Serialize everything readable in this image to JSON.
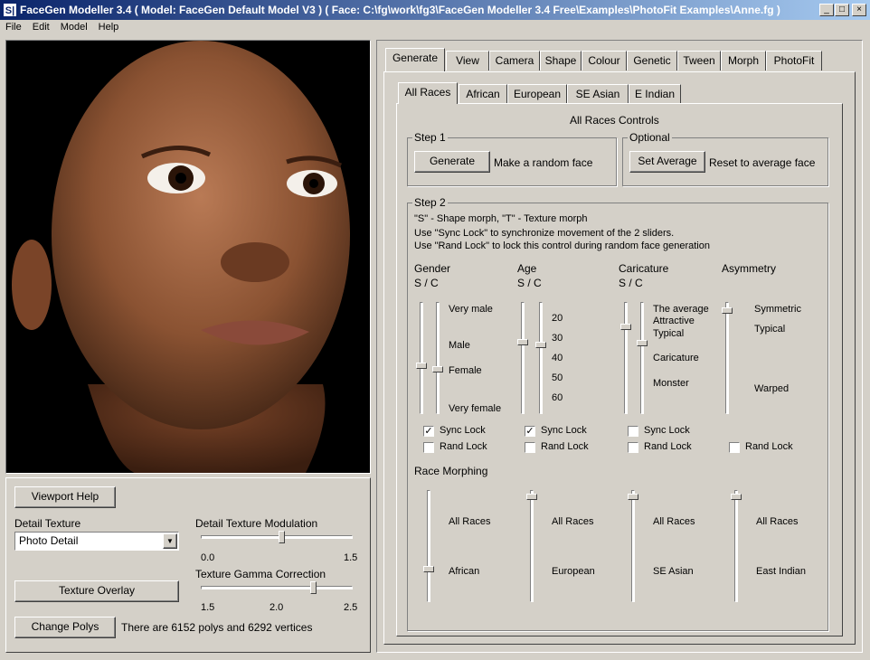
{
  "window": {
    "title": "FaceGen Modeller 3.4  ( Model: FaceGen Default Model V3 )  ( Face: C:\\fg\\work\\fg3\\FaceGen Modeller 3.4 Free\\Examples\\PhotoFit Examples\\Anne.fg )",
    "icon": "S|",
    "min": "_",
    "max": "□",
    "close": "×"
  },
  "menu": [
    "File",
    "Edit",
    "Model",
    "Help"
  ],
  "viewport": {
    "help_btn": "Viewport Help"
  },
  "detail_texture": {
    "label": "Detail Texture",
    "value": "Photo Detail"
  },
  "modulation": {
    "label": "Detail Texture Modulation",
    "min": "0.0",
    "max": "1.5",
    "value": 0.8
  },
  "gamma": {
    "label": "Texture Gamma Correction",
    "t1": "1.5",
    "t2": "2.0",
    "t3": "2.5",
    "value": 0.75
  },
  "texture_overlay_btn": "Texture Overlay",
  "change_polys_btn": "Change Polys",
  "poly_info": "There are 6152 polys and 6292 vertices",
  "tabs": [
    "Generate",
    "View",
    "Camera",
    "Shape",
    "Colour",
    "Genetic",
    "Tween",
    "Morph",
    "PhotoFit"
  ],
  "subtabs": [
    "All Races",
    "African",
    "European",
    "SE Asian",
    "E Indian"
  ],
  "panel_title": "All Races Controls",
  "step1": {
    "label": "Step 1",
    "btn": "Generate",
    "desc": "Make a random face"
  },
  "optional": {
    "label": "Optional",
    "btn": "Set Average",
    "desc": "Reset to average face"
  },
  "step2": {
    "label": "Step 2",
    "line1": "\"S\" - Shape morph, \"T\" - Texture morph",
    "line2": "Use \"Sync Lock\" to synchronize movement of the 2 sliders.",
    "line3": "Use \"Rand Lock\" to lock this control during random face generation"
  },
  "gender": {
    "title": "Gender",
    "sc": "S / C",
    "labels": [
      "Very male",
      "Male",
      "Female",
      "Very female"
    ]
  },
  "age": {
    "title": "Age",
    "sc": "S / C",
    "labels": [
      "20",
      "30",
      "40",
      "50",
      "60"
    ]
  },
  "caricature": {
    "title": "Caricature",
    "sc": "S / C",
    "labels": [
      "The average",
      "Attractive",
      "Typical",
      "Caricature",
      "Monster"
    ]
  },
  "asymmetry": {
    "title": "Asymmetry",
    "labels": [
      "Symmetric",
      "Typical",
      "Warped"
    ]
  },
  "sync_lock": "Sync Lock",
  "rand_lock": "Rand Lock",
  "check_mark": "✓",
  "race_morphing": {
    "title": "Race Morphing",
    "top": "All Races",
    "bottoms": [
      "African",
      "European",
      "SE Asian",
      "East Indian"
    ]
  },
  "dropdown_arrow": "▼"
}
